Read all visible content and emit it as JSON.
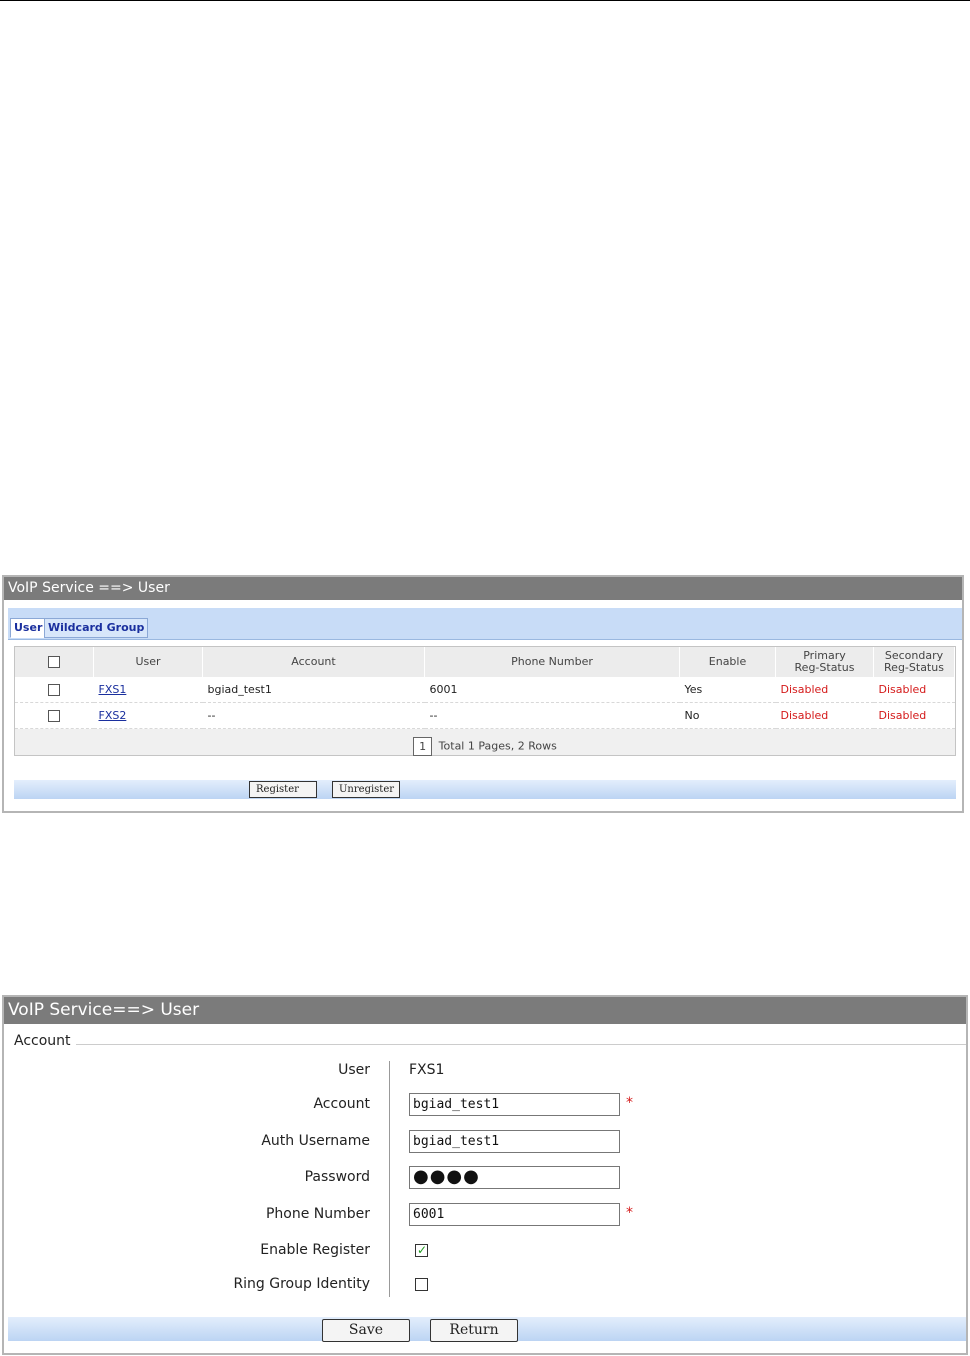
{
  "panel1": {
    "title": "VoIP Service ==> User",
    "tabs": [
      {
        "label": "User",
        "active": true
      },
      {
        "label": "Wildcard Group",
        "active": false
      }
    ],
    "columns": [
      "User",
      "Account",
      "Phone Number",
      "Enable",
      "Primary\nReg-Status",
      "Secondary\nReg-Status"
    ],
    "rows": [
      {
        "user": "FXS1",
        "account": "bgiad_test1",
        "phone": "6001",
        "enable": "Yes",
        "primary": "Disabled",
        "secondary": "Disabled"
      },
      {
        "user": "FXS2",
        "account": "--",
        "phone": "--",
        "enable": "No",
        "primary": "Disabled",
        "secondary": "Disabled"
      }
    ],
    "pager": {
      "page": "1",
      "summary": "Total 1 Pages, 2 Rows"
    },
    "buttons": {
      "register": "Register",
      "unregister": "Unregister"
    }
  },
  "panel2": {
    "title": "VoIP Service==> User",
    "section": "Account",
    "fields": {
      "user_label": "User",
      "user_value": "FXS1",
      "account_label": "Account",
      "account_value": "bgiad_test1",
      "auth_label": "Auth Username",
      "auth_value": "bgiad_test1",
      "password_label": "Password",
      "password_value": "●●●●",
      "phone_label": "Phone Number",
      "phone_value": "6001",
      "enable_register_label": "Enable Register",
      "enable_register_checked": true,
      "ring_group_label": "Ring Group Identity",
      "ring_group_checked": false,
      "required_mark": "*"
    },
    "buttons": {
      "save": "Save",
      "return": "Return"
    }
  },
  "colors": {
    "title_bar": "#7b7b7b",
    "status_red": "#d41a1a",
    "tab_blue": "#1a2f9e",
    "check_green": "#1e9a1e"
  },
  "icons": {
    "checked": "check-icon"
  }
}
